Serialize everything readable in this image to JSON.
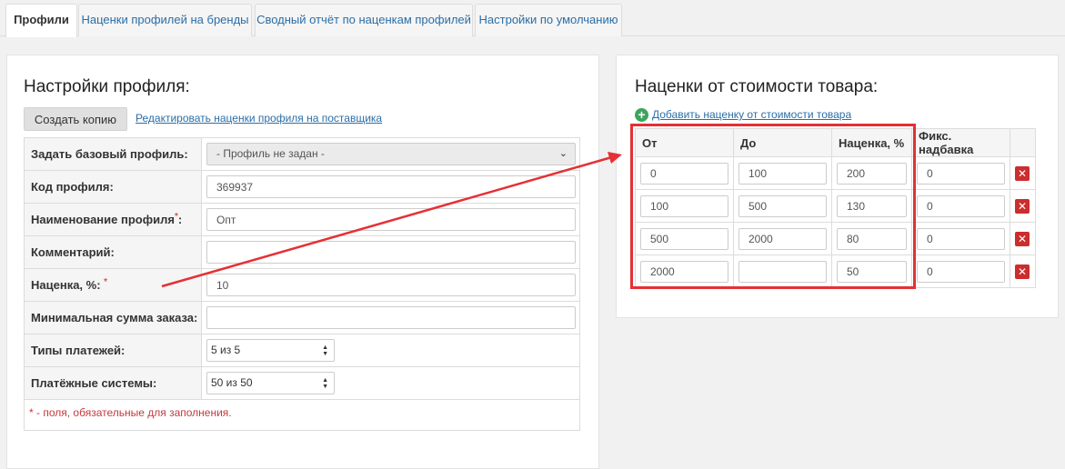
{
  "tabs": [
    {
      "label": "Профили",
      "active": true
    },
    {
      "label": "Наценки профилей на бренды",
      "active": false
    },
    {
      "label": "Сводный отчёт по наценкам профилей",
      "active": false
    },
    {
      "label": "Настройки по умолчанию",
      "active": false
    }
  ],
  "profile": {
    "title": "Настройки профиля:",
    "copy_button": "Создать копию",
    "edit_link": "Редактировать наценки профиля на поставщика",
    "fields": {
      "base_profile": {
        "label": "Задать базовый профиль:",
        "value": "- Профиль не задан -"
      },
      "code": {
        "label": "Код профиля:",
        "value": "369937"
      },
      "name": {
        "label": "Наименование профиля",
        "suffix": ":",
        "value": "Опт"
      },
      "comment": {
        "label": "Комментарий:",
        "value": ""
      },
      "markup": {
        "label": "Наценка, %:",
        "value": "10"
      },
      "min_order": {
        "label": "Минимальная сумма заказа:",
        "value": ""
      },
      "payment_types": {
        "label": "Типы платежей:",
        "value": "5 из 5"
      },
      "payment_systems": {
        "label": "Платёжные системы:",
        "value": "50 из 50"
      }
    },
    "required_mark": "*",
    "required_note": "* - поля, обязательные для заполнения."
  },
  "markups": {
    "title": "Наценки от стоимости товара:",
    "add_link": "Добавить наценку от стоимости товара",
    "headers": [
      "От",
      "До",
      "Наценка, %",
      "Фикс. надбавка"
    ],
    "rows": [
      {
        "from": "0",
        "to": "100",
        "percent": "200",
        "fixed": "0"
      },
      {
        "from": "100",
        "to": "500",
        "percent": "130",
        "fixed": "0"
      },
      {
        "from": "500",
        "to": "2000",
        "percent": "80",
        "fixed": "0"
      },
      {
        "from": "2000",
        "to": "",
        "percent": "50",
        "fixed": "0"
      }
    ]
  },
  "colors": {
    "accent": "#2a6ea7",
    "annotation": "#e53035",
    "required": "#d9534f"
  },
  "icons": {
    "add": "plus-circle-icon",
    "delete": "delete-x-icon"
  }
}
